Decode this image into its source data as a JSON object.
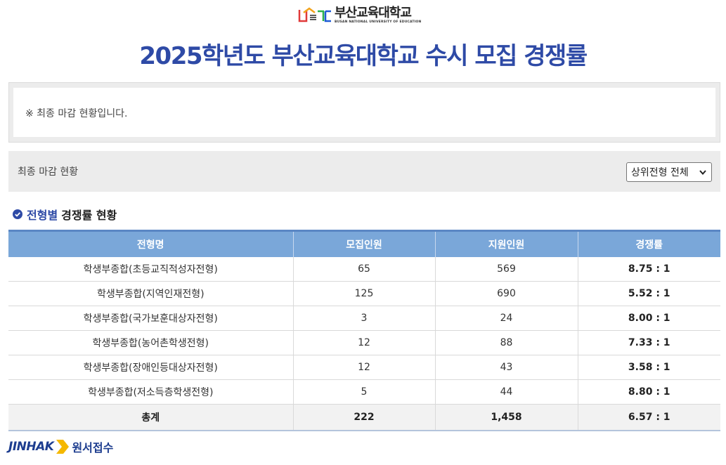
{
  "header": {
    "logo_kr": "부산교육대학교",
    "logo_en": "BUSAN NATIONAL UNIVERSITY OF EDUCATION",
    "title": "2025학년도  부산교육대학교 수시 모집  경쟁률"
  },
  "notice": {
    "text": "※ 최종 마감 현황입니다."
  },
  "filter": {
    "label": "최종 마감 현황",
    "selected": "상위전형 전체"
  },
  "section": {
    "highlight": "전형별",
    "title": "경쟁률 현황"
  },
  "table": {
    "headers": [
      "전형명",
      "모집인원",
      "지원인원",
      "경쟁률"
    ],
    "rows": [
      [
        "학생부종합(초등교직적성자전형)",
        "65",
        "569",
        "8.75 : 1"
      ],
      [
        "학생부종합(지역인재전형)",
        "125",
        "690",
        "5.52 : 1"
      ],
      [
        "학생부종합(국가보훈대상자전형)",
        "3",
        "24",
        "8.00 : 1"
      ],
      [
        "학생부종합(농어촌학생전형)",
        "12",
        "88",
        "7.33 : 1"
      ],
      [
        "학생부종합(장애인등대상자전형)",
        "12",
        "43",
        "3.58 : 1"
      ],
      [
        "학생부종합(저소득층학생전형)",
        "5",
        "44",
        "8.80 : 1"
      ]
    ],
    "total": [
      "총계",
      "222",
      "1,458",
      "6.57 : 1"
    ]
  },
  "footer": {
    "brand": "JINHAK",
    "service": "원서접수"
  },
  "colors": {
    "title": "#2e4aa6",
    "header_bg": "#7aa7d9",
    "accent_arrow": "#f5b800"
  }
}
